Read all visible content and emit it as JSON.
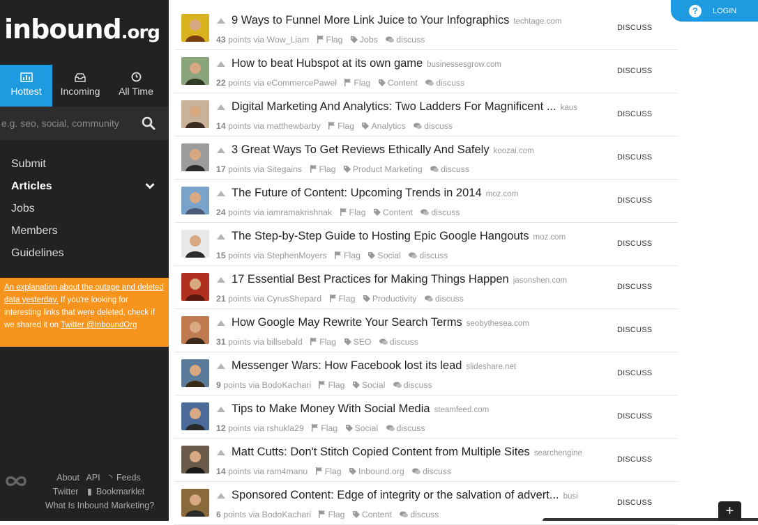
{
  "sidebar": {
    "logo_main": "inbound",
    "logo_tld": ".org",
    "tabs": [
      {
        "label": "Hottest",
        "icon": "bar-chart-icon"
      },
      {
        "label": "Incoming",
        "icon": "inbox-icon"
      },
      {
        "label": "All Time",
        "icon": "clock-icon"
      }
    ],
    "search_placeholder": "e.g. seo, social, community",
    "nav": [
      "Submit",
      "Articles",
      "Jobs",
      "Members",
      "Guidelines"
    ],
    "notice": {
      "link_text": "An explanation about the outage and deleted data yesterday.",
      "text": " If you're looking for interesting links that were deleted, check if we shared it on ",
      "twitter_link": "Twitter @InboundOrg"
    },
    "footer": {
      "about": "About",
      "api": "API",
      "feeds": "Feeds",
      "twitter": "Twitter",
      "bookmarklet": "Bookmarklet",
      "what_is": "What Is Inbound Marketing?"
    }
  },
  "header": {
    "login_label": "LOGIN",
    "help_glyph": "?"
  },
  "labels": {
    "discuss_button": "DISCUSS",
    "flag": "Flag",
    "discuss": "discuss",
    "points_suffix": "points via",
    "plus": "+"
  },
  "colors": {
    "accent": "#1e9ae0",
    "notice": "#f7941d",
    "sidebar": "#222222"
  },
  "articles": [
    {
      "title": "9 Ways to Funnel More Link Juice to Your Infographics",
      "domain": "techtage.com",
      "points": "43",
      "user": "Wow_Liam",
      "tag": "Jobs"
    },
    {
      "title": "How to beat Hubspot at its own game",
      "domain": "businessesgrow.com",
      "points": "22",
      "user": "eCommercePawel",
      "tag": "Content"
    },
    {
      "title": "Digital Marketing And Analytics: Two Ladders For Magnificent ...",
      "domain": "kaus",
      "points": "14",
      "user": "matthewbarby",
      "tag": "Analytics"
    },
    {
      "title": "3 Great Ways To Get Reviews Ethically And Safely",
      "domain": "koozai.com",
      "points": "17",
      "user": "Sitegains",
      "tag": "Product Marketing"
    },
    {
      "title": "The Future of Content: Upcoming Trends in 2014",
      "domain": "moz.com",
      "points": "24",
      "user": "iamramakrishnak",
      "tag": "Content"
    },
    {
      "title": "The Step-by-Step Guide to Hosting Epic Google Hangouts",
      "domain": "moz.com",
      "points": "15",
      "user": "StephenMoyers",
      "tag": "Social"
    },
    {
      "title": "17 Essential Best Practices for Making Things Happen",
      "domain": "jasonshen.com",
      "points": "21",
      "user": "CyrusShepard",
      "tag": "Productivity"
    },
    {
      "title": "How Google May Rewrite Your Search Terms",
      "domain": "seobythesea.com",
      "points": "31",
      "user": "billsebald",
      "tag": "SEO"
    },
    {
      "title": "Messenger Wars: How Facebook lost its lead",
      "domain": "slideshare.net",
      "points": "9",
      "user": "BodoKachari",
      "tag": "Social"
    },
    {
      "title": "Tips to Make Money With Social Media",
      "domain": "steamfeed.com",
      "points": "12",
      "user": "rshukla29",
      "tag": "Social"
    },
    {
      "title": "Matt Cutts: Don't Stitch Copied Content from Multiple Sites",
      "domain": "searchengine",
      "points": "14",
      "user": "ram4manu",
      "tag": "Inbound.org"
    },
    {
      "title": "Sponsored Content: Edge of integrity or the salvation of advert...",
      "domain": "busi",
      "points": "6",
      "user": "BodoKachari",
      "tag": "Content"
    }
  ]
}
